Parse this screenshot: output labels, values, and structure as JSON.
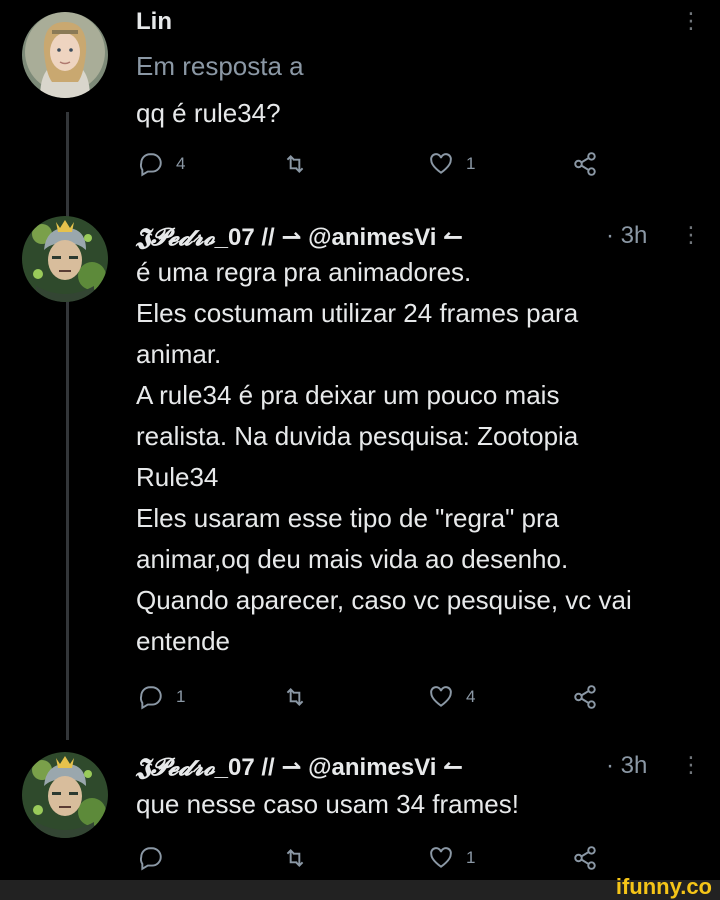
{
  "tweet1": {
    "name": "Lin",
    "reply_context": "Em resposta a",
    "text_lines": [
      "qq é rule34?"
    ],
    "stats": {
      "reply": "4",
      "retweet": "",
      "like": "1"
    }
  },
  "tweet2": {
    "name_script": "𝕵𝓟𝓮𝓭𝓻𝓸",
    "name_rest": "_07 // ⇀ @animesVi ↼",
    "time": "· 3h",
    "text_lines": [
      "é uma regra pra animadores.",
      "Eles costumam utilizar 24 frames para",
      "animar.",
      "A rule34 é pra deixar um pouco mais",
      "realista. Na duvida pesquisa: Zootopia",
      "Rule34",
      "Eles usaram esse tipo de \"regra\" pra",
      "animar,oq deu mais vida ao desenho.",
      "Quando aparecer, caso vc pesquise, vc vai",
      "entende"
    ],
    "stats": {
      "reply": "1",
      "retweet": "",
      "like": "4"
    }
  },
  "tweet3": {
    "name_script": "𝕵𝓟𝓮𝓭𝓻𝓸",
    "name_rest": "_07 // ⇀ @animesVi ↼",
    "time": "· 3h",
    "text_lines": [
      "que nesse caso usam 34 frames!"
    ],
    "stats": {
      "reply": "",
      "retweet": "",
      "like": "1"
    }
  },
  "watermark": "ifunny.co",
  "colors": {
    "background": "#000000",
    "text": "#e7e9ea",
    "muted": "#8b98a5",
    "watermark": "#f5c518"
  },
  "icons": [
    "more-icon",
    "reply-icon",
    "retweet-icon",
    "like-icon",
    "share-icon"
  ]
}
